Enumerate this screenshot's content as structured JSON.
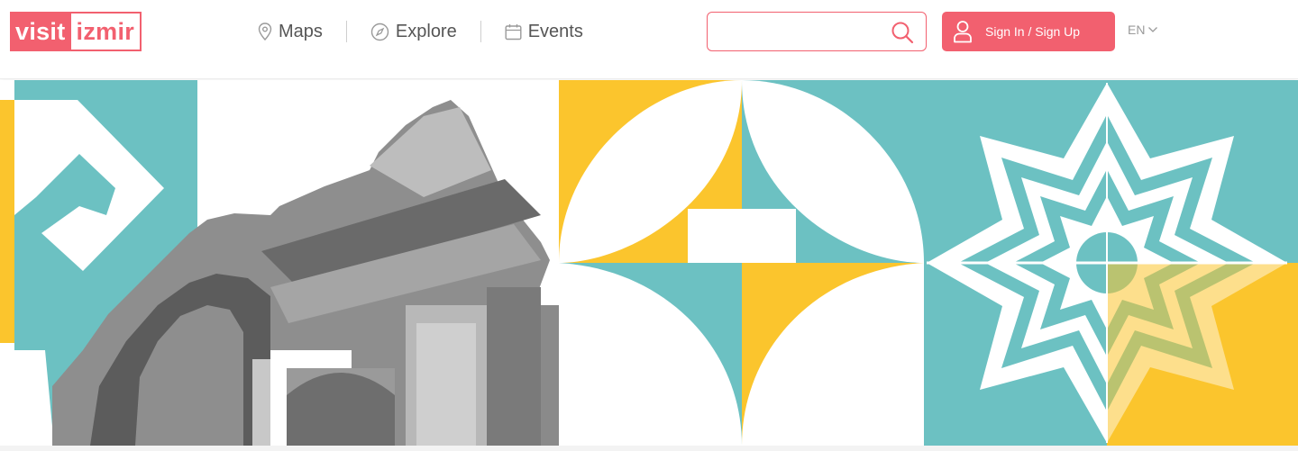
{
  "header": {
    "logo": {
      "visit": "visit",
      "izmir": "izmir"
    },
    "nav": [
      {
        "label": "Maps",
        "icon": "map-pin-icon"
      },
      {
        "label": "Explore",
        "icon": "compass-icon"
      },
      {
        "label": "Events",
        "icon": "calendar-icon"
      }
    ],
    "search": {
      "placeholder": "",
      "value": "",
      "icon": "search-icon"
    },
    "signin": {
      "label": "Sign In / Sign Up",
      "icon": "user-icon"
    },
    "language": {
      "label": "EN",
      "icon": "chevron-down-icon"
    }
  },
  "colors": {
    "brand": "#f2606f",
    "teal": "#6cc1c2",
    "yellow": "#fbc52d",
    "white": "#ffffff"
  }
}
